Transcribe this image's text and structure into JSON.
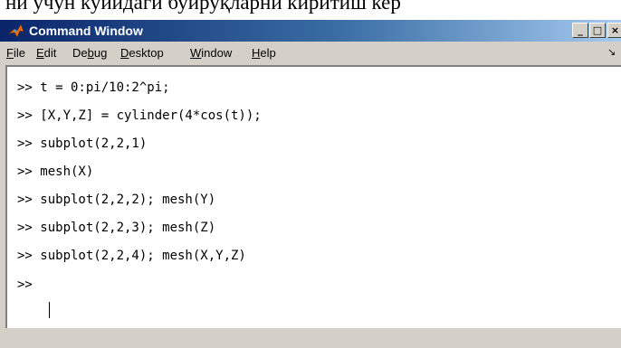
{
  "document": {
    "cutoff_text": "ни учун куйидаги буйруқларни киритиш кер"
  },
  "window": {
    "title": "Command Window",
    "icon": "matlab-logo-icon",
    "controls": {
      "minimize": "_",
      "maximize": "□",
      "close": "×"
    }
  },
  "menubar": {
    "items": [
      {
        "accel": "F",
        "rest": "ile"
      },
      {
        "accel": "E",
        "rest": "dit"
      },
      {
        "pre": "De",
        "accel": "b",
        "rest": "ug"
      },
      {
        "accel": "D",
        "rest": "esktop"
      },
      {
        "accel": "W",
        "rest": "indow"
      },
      {
        "accel": "H",
        "rest": "elp"
      }
    ],
    "overflow_icon": "undock-arrow-icon"
  },
  "command_window": {
    "lines": [
      ">> t = 0:pi/10:2^pi;",
      ">> [X,Y,Z] = cylinder(4*cos(t));",
      ">> subplot(2,2,1)",
      ">> mesh(X)",
      ">> subplot(2,2,2); mesh(Y)",
      ">> subplot(2,2,3); mesh(Z)",
      ">> subplot(2,2,4); mesh(X,Y,Z)",
      ">> "
    ]
  }
}
